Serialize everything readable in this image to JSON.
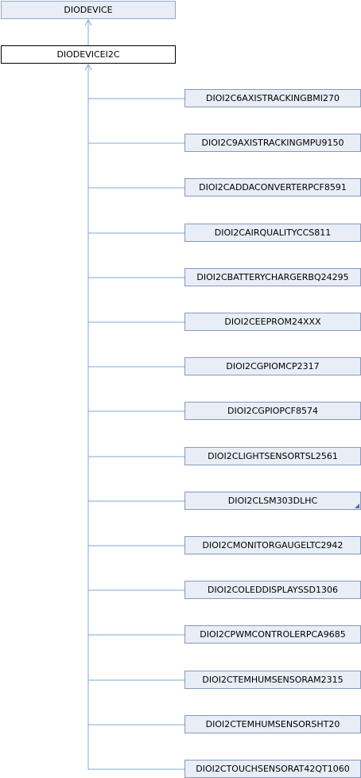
{
  "diagram": {
    "base_class": "DIODEVICE",
    "current_class": "DIODEVICEI2C",
    "children": [
      {
        "label": "DIOI2C6AXISTRACKINGBMI270",
        "has_more": false
      },
      {
        "label": "DIOI2C9AXISTRACKINGMPU9150",
        "has_more": false
      },
      {
        "label": "DIOI2CADDACONVERTERPCF8591",
        "has_more": false
      },
      {
        "label": "DIOI2CAIRQUALITYCCS811",
        "has_more": false
      },
      {
        "label": "DIOI2CBATTERYCHARGERBQ24295",
        "has_more": false
      },
      {
        "label": "DIOI2CEEPROM24XXX",
        "has_more": false
      },
      {
        "label": "DIOI2CGPIOMCP2317",
        "has_more": false
      },
      {
        "label": "DIOI2CGPIOPCF8574",
        "has_more": false
      },
      {
        "label": "DIOI2CLIGHTSENSORTSL2561",
        "has_more": false
      },
      {
        "label": "DIOI2CLSM303DLHC",
        "has_more": true
      },
      {
        "label": "DIOI2CMONITORGAUGELTC2942",
        "has_more": false
      },
      {
        "label": "DIOI2COLEDDISPLAYSSD1306",
        "has_more": false
      },
      {
        "label": "DIOI2CPWMCONTROLERPCA9685",
        "has_more": false
      },
      {
        "label": "DIOI2CTEMHUMSENSORAM2315",
        "has_more": false
      },
      {
        "label": "DIOI2CTEMHUMSENSORSHT20",
        "has_more": false
      },
      {
        "label": "DIOI2CTOUCHSENSORAT42QT1060",
        "has_more": false
      }
    ],
    "edge_color": "#7fa8d8"
  }
}
